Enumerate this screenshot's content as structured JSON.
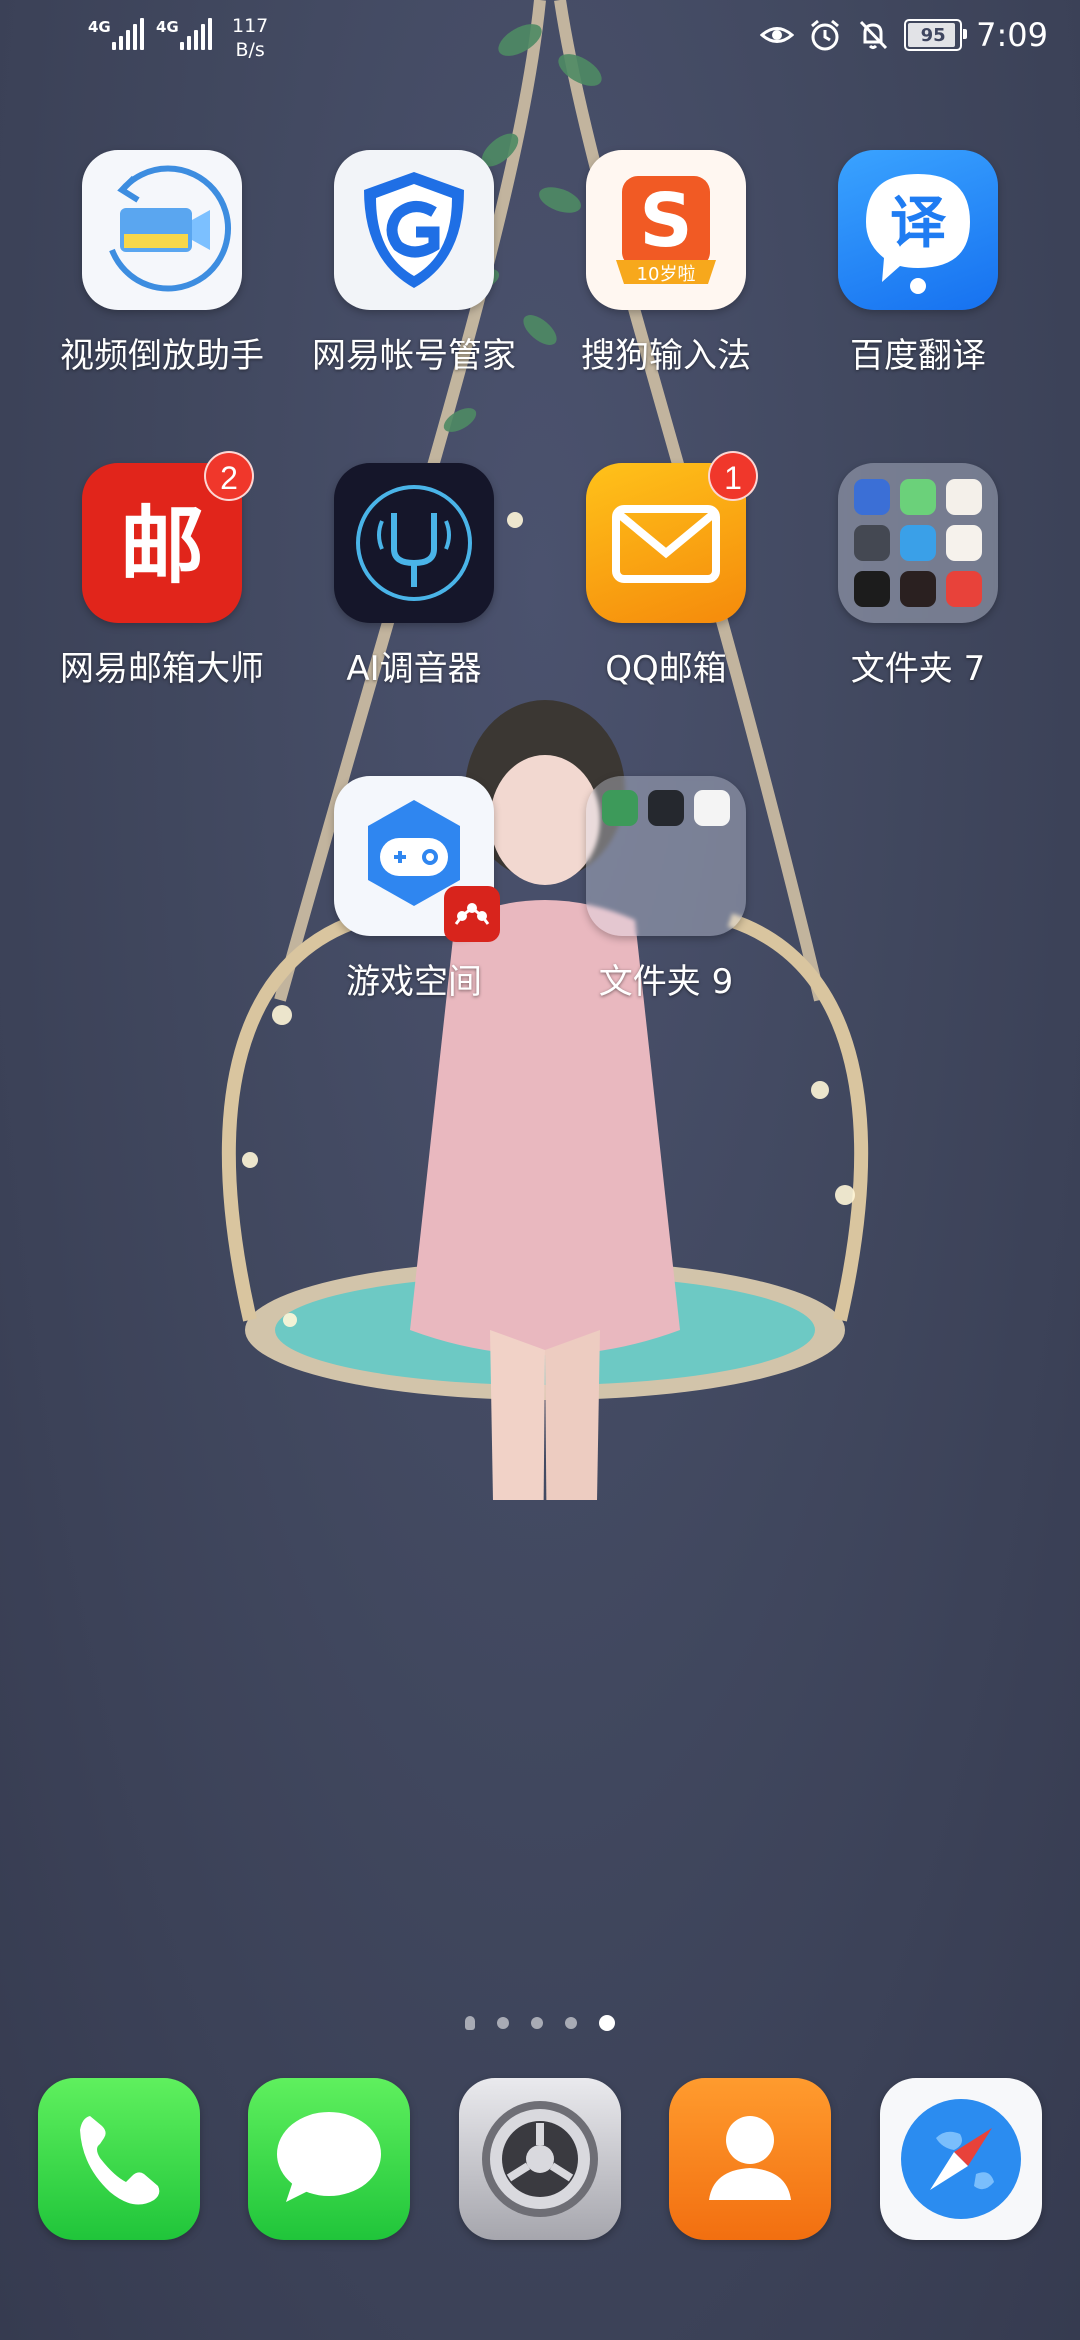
{
  "status_bar": {
    "signal1_label": "4G",
    "signal2_label": "4G",
    "net_speed_value": "117",
    "net_speed_unit": "B/s",
    "battery_level": "95",
    "time": "7:09",
    "icons": [
      "eye-comfort-icon",
      "alarm-icon",
      "notifications-muted-icon",
      "battery-icon"
    ]
  },
  "apps": [
    {
      "id": "video-reverse",
      "label": "视频倒放助手",
      "icon": "video-reverse-icon",
      "badge": null
    },
    {
      "id": "netease-account",
      "label": "网易帐号管家",
      "icon": "shield-g-icon",
      "badge": null
    },
    {
      "id": "sogou-input",
      "label": "搜狗输入法",
      "icon": "sogou-s-icon",
      "badge": null,
      "icon_text": "S",
      "banner": "10岁啦"
    },
    {
      "id": "baidu-translate",
      "label": "百度翻译",
      "icon": "translate-icon",
      "badge": null,
      "icon_text": "译"
    },
    {
      "id": "netease-mail",
      "label": "网易邮箱大师",
      "icon": "mail-master-icon",
      "badge": "2",
      "icon_text": "邮"
    },
    {
      "id": "ai-tuner",
      "label": "AI调音器",
      "icon": "tuning-fork-icon",
      "badge": null
    },
    {
      "id": "qq-mail",
      "label": "QQ邮箱",
      "icon": "envelope-icon",
      "badge": "1"
    },
    {
      "id": "folder-7",
      "label": "文件夹 7",
      "icon": "folder-icon",
      "badge": null
    },
    {
      "id": "game-space",
      "label": "游戏空间",
      "icon": "gamepad-icon",
      "badge": null
    },
    {
      "id": "folder-9",
      "label": "文件夹 9",
      "icon": "folder-icon",
      "badge": null
    }
  ],
  "page_indicator": {
    "pages": 5,
    "current": 5
  },
  "dock": [
    {
      "id": "phone",
      "icon": "phone-icon"
    },
    {
      "id": "messages",
      "icon": "message-bubble-icon"
    },
    {
      "id": "settings",
      "icon": "gear-icon"
    },
    {
      "id": "contacts",
      "icon": "contact-person-icon"
    },
    {
      "id": "browser",
      "icon": "compass-icon"
    }
  ],
  "colors": {
    "wallpaper": "#41485f",
    "badge": "#f0372b",
    "phone": "#2ecc40",
    "settings": "#8e8e93",
    "contacts": "#f5891e"
  }
}
